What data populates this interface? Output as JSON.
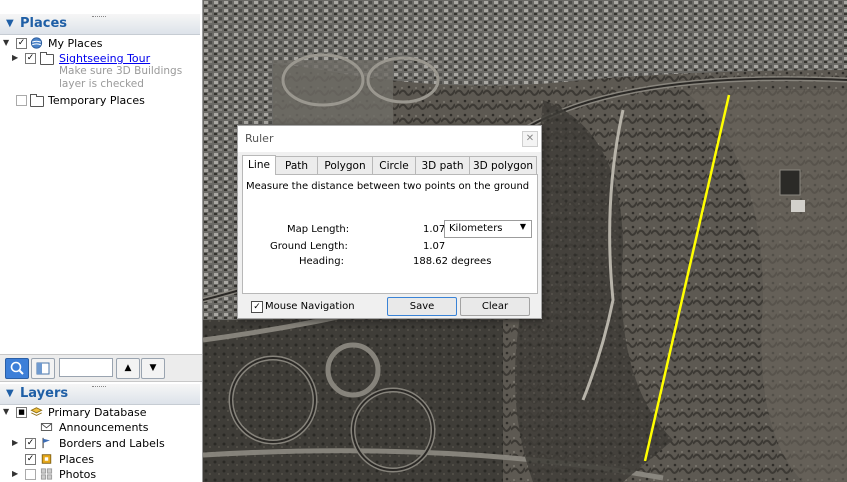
{
  "places": {
    "header": "Places",
    "my_places": "My Places",
    "tour": "Sightseeing Tour",
    "tour_desc_line1": "Make sure 3D Buildings",
    "tour_desc_line2": "layer is checked",
    "temporary": "Temporary Places"
  },
  "toolbar": {
    "search_value": "",
    "up_icon": "▲",
    "down_icon": "▼"
  },
  "layers": {
    "header": "Layers",
    "items": [
      {
        "label": "Primary Database"
      },
      {
        "label": "Announcements"
      },
      {
        "label": "Borders and Labels"
      },
      {
        "label": "Places"
      },
      {
        "label": "Photos"
      }
    ]
  },
  "ruler": {
    "title": "Ruler",
    "close": "✕",
    "tabs": [
      "Line",
      "Path",
      "Polygon",
      "Circle",
      "3D path",
      "3D polygon"
    ],
    "active_tab": "Line",
    "instruction": "Measure the distance between two points on the ground",
    "map_length_label": "Map Length:",
    "map_length_value": "1.07",
    "unit": "Kilometers",
    "ground_length_label": "Ground Length:",
    "ground_length_value": "1.07",
    "heading_label": "Heading:",
    "heading_value": "188.62 degrees",
    "mouse_nav_label": "Mouse Navigation",
    "mouse_nav_checked": true,
    "save_label": "Save",
    "clear_label": "Clear"
  },
  "colors": {
    "accent": "#1f5fa6",
    "measure_line": "#ffff00",
    "link": "#0000ee"
  }
}
